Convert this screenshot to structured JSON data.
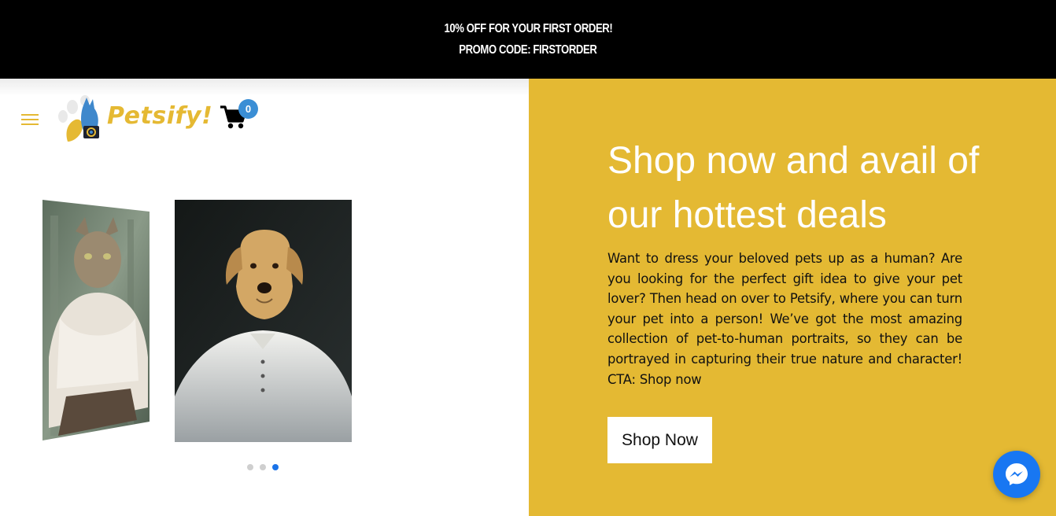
{
  "promo": {
    "line1": "10% OFF FOR YOUR FIRST ORDER!",
    "line2": "PROMO CODE: FIRSTORDER"
  },
  "header": {
    "menu_icon": "hamburger-icon",
    "logo_text": "Petsify!",
    "cart_icon": "shopping-cart-icon",
    "cart_count": "0"
  },
  "carousel": {
    "slides": [
      "cat-in-white-blouse-portrait",
      "dog-in-white-shirt-portrait"
    ],
    "dot_count": 3,
    "active_index": 2
  },
  "hero": {
    "title": "Shop now and avail of our hottest deals",
    "body": "Want to dress your beloved pets up as a human? Are you looking for the perfect gift idea to give your pet lover? Then head on over to Petsify, where you can turn your pet into a person! We’ve got the most amazing collection of pet-to-human portraits, so they can be portrayed in capturing their true nature and character! CTA: Shop now",
    "button_label": "Shop Now"
  },
  "chat": {
    "icon": "messenger-icon"
  },
  "colors": {
    "accent": "#e4b933",
    "promo_bg": "#000000",
    "badge": "#3a8ed5",
    "messenger": "#1877f2"
  }
}
